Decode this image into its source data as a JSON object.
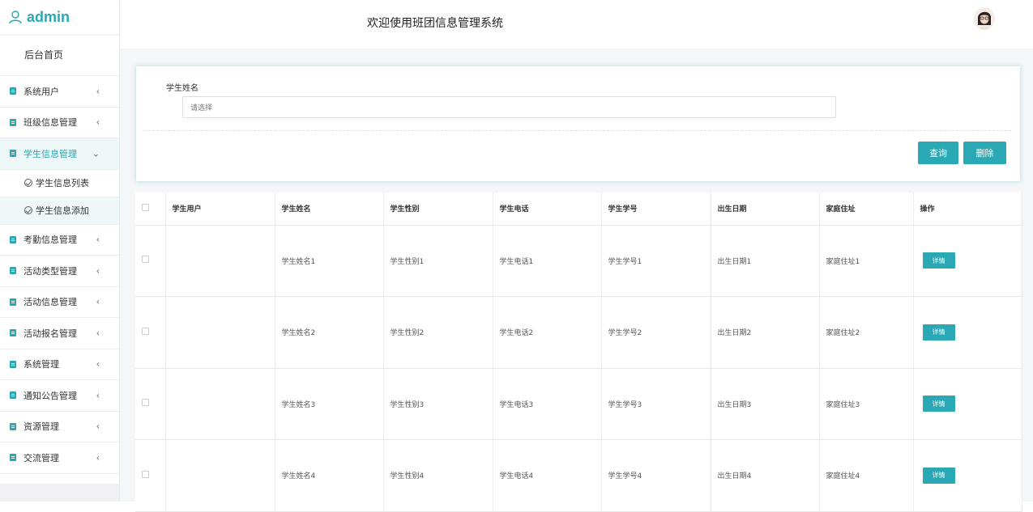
{
  "app": {
    "brand": "admin",
    "header_title": "欢迎使用班团信息管理系统"
  },
  "sidebar": {
    "home": "后台首页",
    "items": [
      {
        "label": "系统用户",
        "open": false
      },
      {
        "label": "班级信息管理",
        "open": false
      },
      {
        "label": "学生信息管理",
        "open": true,
        "children": [
          "学生信息列表",
          "学生信息添加"
        ]
      },
      {
        "label": "考勤信息管理",
        "open": false
      },
      {
        "label": "活动类型管理",
        "open": false
      },
      {
        "label": "活动信息管理",
        "open": false
      },
      {
        "label": "活动报名管理",
        "open": false
      },
      {
        "label": "系统管理",
        "open": false
      },
      {
        "label": "通知公告管理",
        "open": false
      },
      {
        "label": "资源管理",
        "open": false
      },
      {
        "label": "交流管理",
        "open": false
      }
    ]
  },
  "search": {
    "label": "学生姓名",
    "placeholder": "请选择",
    "query_label": "查询",
    "delete_label": "删除"
  },
  "table": {
    "columns": [
      "学生用户",
      "学生姓名",
      "学生性别",
      "学生电话",
      "学生学号",
      "出生日期",
      "家庭住址",
      "操作"
    ],
    "rows": [
      [
        "",
        "学生姓名1",
        "学生性别1",
        "学生电话1",
        "学生学号1",
        "出生日期1",
        "家庭住址1"
      ],
      [
        "",
        "学生姓名2",
        "学生性别2",
        "学生电话2",
        "学生学号2",
        "出生日期2",
        "家庭住址2"
      ],
      [
        "",
        "学生姓名3",
        "学生性别3",
        "学生电话3",
        "学生学号3",
        "出生日期3",
        "家庭住址3"
      ],
      [
        "",
        "学生姓名4",
        "学生性别4",
        "学生电话4",
        "学生学号4",
        "出生日期4",
        "家庭住址4"
      ]
    ],
    "action_label": "详情"
  },
  "colors": {
    "accent": "#2aa8b3",
    "active_bg": "#eef8f8"
  }
}
